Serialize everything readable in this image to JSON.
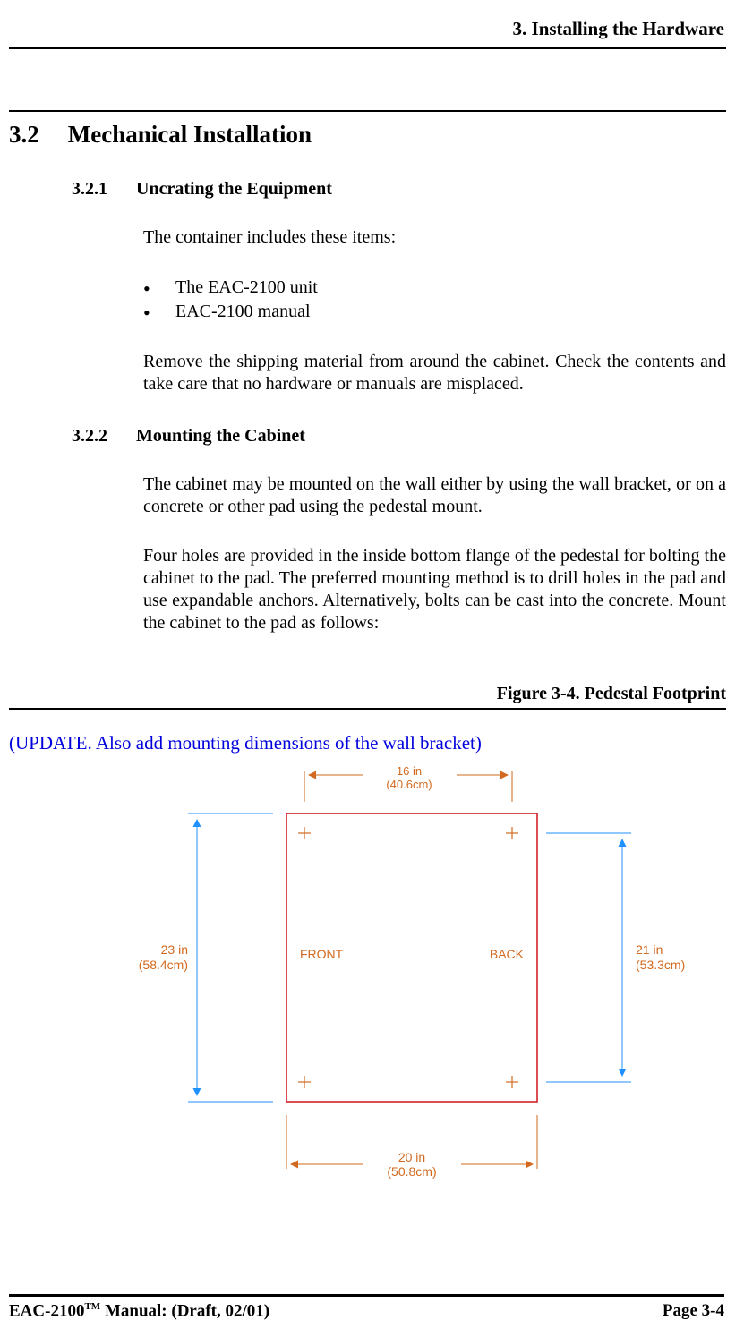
{
  "header": {
    "chapter_title": "3. Installing the Hardware"
  },
  "section": {
    "number": "3.2",
    "title": "Mechanical Installation"
  },
  "sub1": {
    "number": "3.2.1",
    "title": "Uncrating the Equipment",
    "intro": "The container includes these items:",
    "items": [
      "The EAC-2100 unit",
      "EAC-2100 manual"
    ],
    "para2": "Remove the shipping material from around the cabinet. Check the contents and take care that no hardware or manuals are misplaced."
  },
  "sub2": {
    "number": "3.2.2",
    "title": "Mounting the Cabinet",
    "para1": "The cabinet may be mounted on the wall either by using the wall bracket, or on a concrete or other pad using the pedestal mount.",
    "para2": "Four holes are provided in the inside bottom flange of the pedestal for bolting the cabinet to the pad. The preferred mounting method is to drill holes in the pad and use expandable anchors. Alternatively, bolts can be cast into the concrete. Mount the cabinet to the pad as follows:"
  },
  "figure": {
    "title": "Figure 3-4. Pedestal Footprint",
    "update_note": "(UPDATE.  Also add mounting dimensions of the wall bracket)"
  },
  "diagram": {
    "top_dim_in": "16 in",
    "top_dim_cm": "(40.6cm)",
    "left_dim_in": "23 in",
    "left_dim_cm": "(58.4cm)",
    "right_dim_in": "21 in",
    "right_dim_cm": "(53.3cm)",
    "bottom_dim_in": "20 in",
    "bottom_dim_cm": "(50.8cm)",
    "front_label": "FRONT",
    "back_label": "BACK"
  },
  "footer": {
    "manual_ref_prefix": "EAC-2100",
    "manual_ref_suffix": " Manual: (Draft, 02/01)",
    "page": "Page 3-4"
  }
}
